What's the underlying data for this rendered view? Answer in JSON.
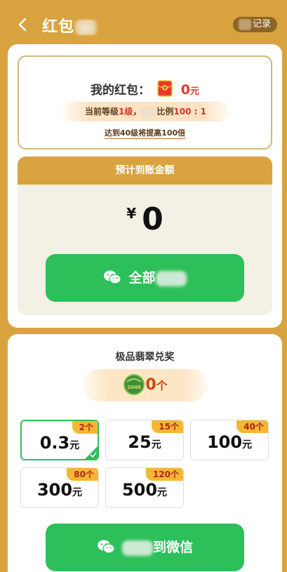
{
  "header": {
    "title": "红包",
    "record_label": "记录"
  },
  "balance": {
    "label": "我的红包：",
    "amount": "0",
    "unit": "元",
    "level_prefix": "当前等级",
    "level_value": "1级",
    "level_separator": "，",
    "ratio_prefix": "比例",
    "ratio_value": "100 : 1",
    "level_link": "达到40级将提高100倍"
  },
  "estimate": {
    "header": "预计到账金额",
    "currency": "¥",
    "amount": "0",
    "button_label": "全部"
  },
  "jade": {
    "title": "极品翡翠兑奖",
    "icon_text": "2048",
    "count": "0",
    "unit": "个"
  },
  "options": [
    {
      "value": "0.3",
      "unit": "元",
      "badge": "2个",
      "selected": true
    },
    {
      "value": "25",
      "unit": "元",
      "badge": "15个",
      "selected": false
    },
    {
      "value": "100",
      "unit": "元",
      "badge": "40个",
      "selected": false
    },
    {
      "value": "300",
      "unit": "元",
      "badge": "80个",
      "selected": false
    },
    {
      "value": "500",
      "unit": "元",
      "badge": "120个",
      "selected": false
    }
  ],
  "bottom_button": {
    "label": "到微信"
  },
  "colors": {
    "background": "#d9a33f",
    "accent_green": "#2dbf5a",
    "red": "#e03a2a",
    "badge_orange": "#f5b731"
  }
}
